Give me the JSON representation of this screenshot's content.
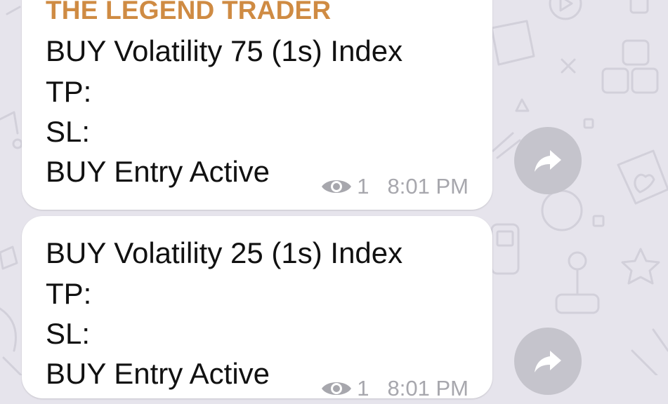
{
  "messages": [
    {
      "sender": "THE LEGEND TRADER",
      "lines": [
        "BUY Volatility 75 (1s) Index",
        "TP:",
        "SL:",
        "BUY Entry Active"
      ],
      "views": "1",
      "time": "8:01 PM"
    },
    {
      "lines": [
        "BUY Volatility 25 (1s) Index",
        "TP:",
        "SL:",
        "BUY Entry Active"
      ],
      "views": "1",
      "time": "8:01 PM"
    }
  ],
  "icons": {
    "views": "eye-icon",
    "share": "share-arrow-icon"
  },
  "colors": {
    "background": "#e6e4ec",
    "bubble": "#ffffff",
    "sender": "#cf8b43",
    "meta": "#a7a7ad",
    "share_button": "#c5c4cc"
  }
}
